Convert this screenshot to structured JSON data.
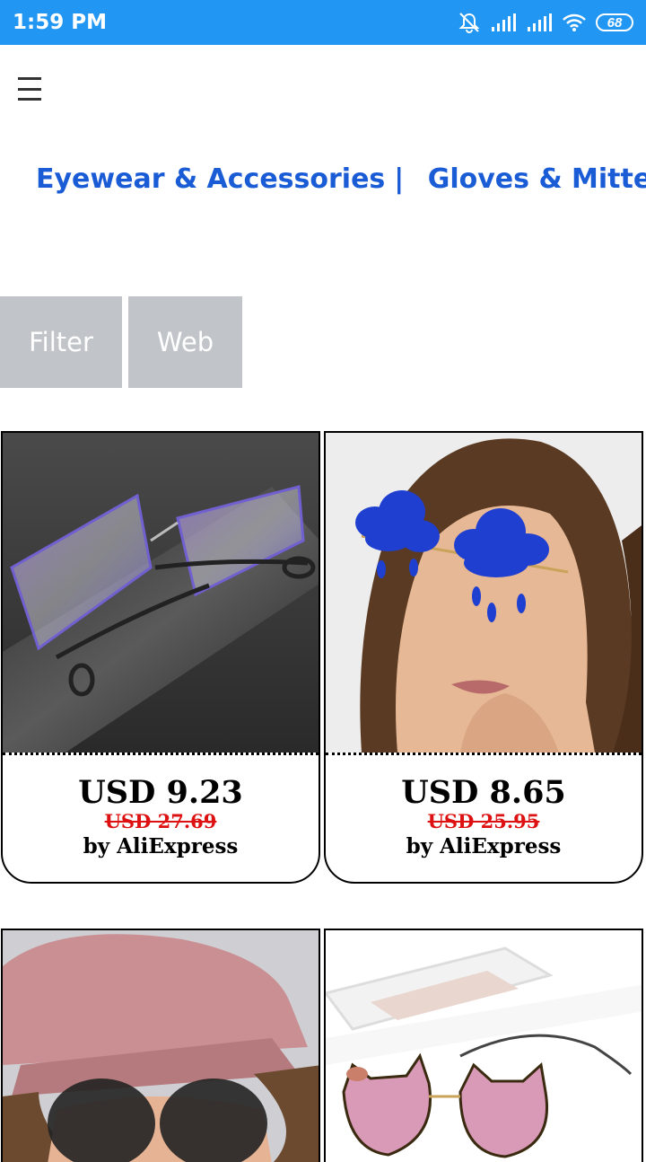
{
  "status_bar": {
    "time": "1:59 PM",
    "battery": "68",
    "icons": [
      "mute-icon",
      "signal-icon",
      "signal-icon",
      "wifi-icon",
      "battery-icon"
    ]
  },
  "header": {
    "menu_icon": "hamburger-menu-icon"
  },
  "categories": {
    "items": [
      "Eyewear & Accessories",
      "Gloves & Mittens"
    ],
    "separator": "|"
  },
  "buttons": {
    "filter": "Filter",
    "web": "Web"
  },
  "products": [
    {
      "price": "USD 9.23",
      "old_price": "USD 27.69",
      "seller": "by AliExpress"
    },
    {
      "price": "USD 8.65",
      "old_price": "USD 25.95",
      "seller": "by AliExpress"
    }
  ],
  "colors": {
    "status_bar": "#2196F3",
    "category_link": "#1a5bd6",
    "button_gray": "#c1c4c9",
    "old_price": "#dd1111"
  }
}
